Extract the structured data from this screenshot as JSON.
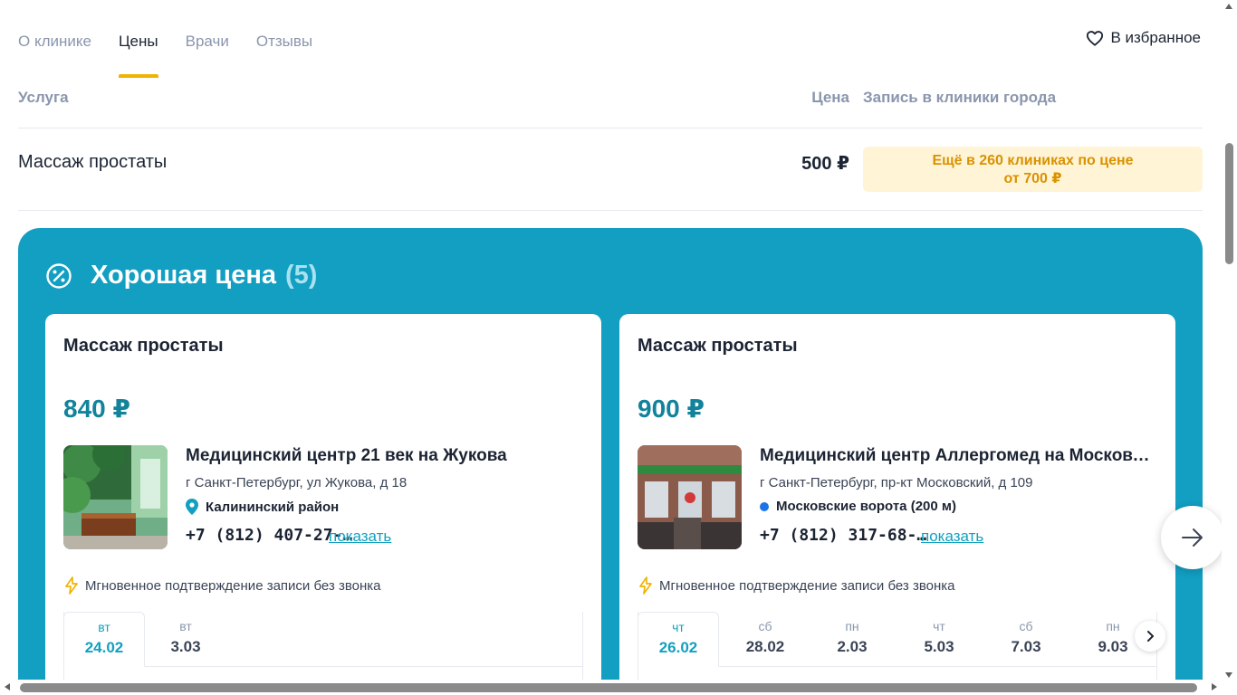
{
  "tabs": [
    {
      "label": "О клинике"
    },
    {
      "label": "Цены",
      "active": true
    },
    {
      "label": "Врачи"
    },
    {
      "label": "Отзывы"
    }
  ],
  "favorite": {
    "label": "В избранное",
    "icon": "heart-icon"
  },
  "table": {
    "headers": {
      "service": "Услуга",
      "price": "Цена",
      "booking": "Запись в клиники города"
    },
    "row": {
      "service": "Массаж простаты",
      "price": "500 ₽",
      "more_line1": "Ещё в 260 клиниках по цене",
      "more_line2": "от 700 ₽"
    }
  },
  "good_price": {
    "icon": "percent-badge-icon",
    "title": "Хорошая цена",
    "count": "(5)",
    "accent_color": "#129fc2",
    "cards": [
      {
        "service": "Массаж простаты",
        "price": "840 ₽",
        "clinic": "Медицинский центр 21 век на Жукова",
        "address": "г Санкт-Петербург, ул Жукова, д 18",
        "location": "Калининский район",
        "location_icon": "map-pin-icon",
        "phone": "+7 (812) 407-27-…",
        "show_phone": "показать",
        "instant": "Мгновенное подтверждение записи без звонка",
        "dates": [
          {
            "weekday": "вт",
            "date": "24.02",
            "selected": true
          },
          {
            "weekday": "вт",
            "date": "3.03"
          }
        ]
      },
      {
        "service": "Массаж простаты",
        "price": "900 ₽",
        "clinic": "Медицинский центр Аллергомед на Московском",
        "address": "г Санкт-Петербург, пр-кт Московский, д 109",
        "location": "Московские ворота (200 м)",
        "location_icon": "metro-dot-icon",
        "phone": "+7 (812) 317-68-…",
        "show_phone": "показать",
        "instant": "Мгновенное подтверждение записи без звонка",
        "dates": [
          {
            "weekday": "чт",
            "date": "26.02",
            "selected": true
          },
          {
            "weekday": "сб",
            "date": "28.02"
          },
          {
            "weekday": "пн",
            "date": "2.03"
          },
          {
            "weekday": "чт",
            "date": "5.03"
          },
          {
            "weekday": "сб",
            "date": "7.03"
          },
          {
            "weekday": "пн",
            "date": "9.03"
          }
        ]
      }
    ]
  }
}
